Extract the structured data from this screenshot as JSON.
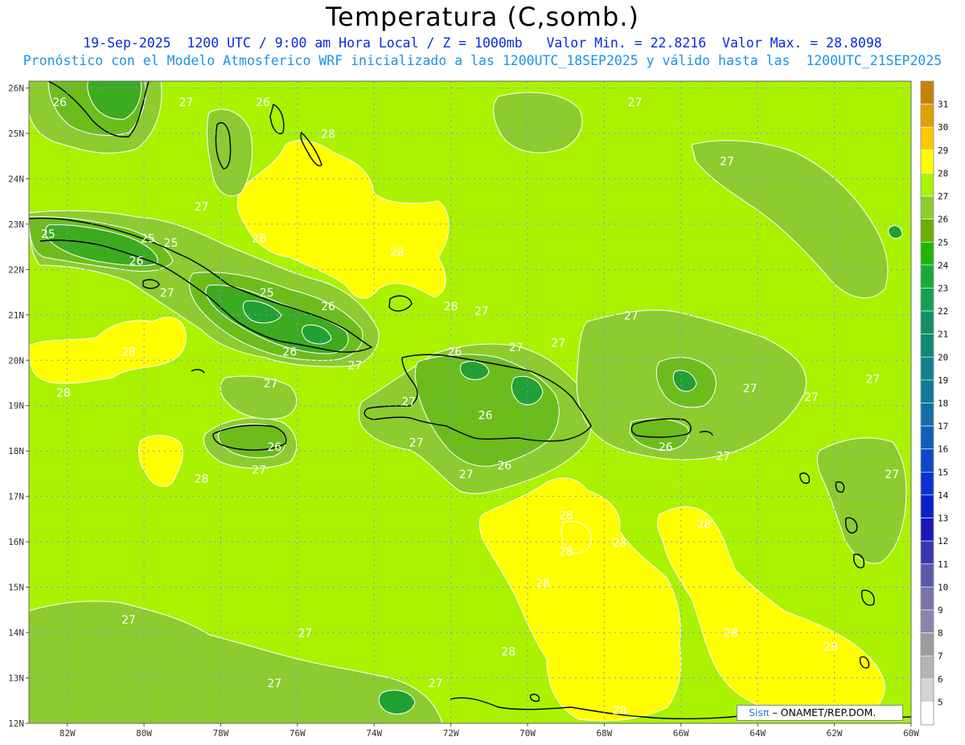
{
  "header": {
    "title": "Temperatura (C,somb.)",
    "subtitle_line1": "19-Sep-2025  1200 UTC / 9:00 am Hora Local / Z = 1000mb   Valor Min. = 22.8216  Valor Max. = 28.8098",
    "subtitle_line2": "Pronóstico con el Modelo Atmosferico WRF inicializado a las 1200UTC_18SEP2025 y válido hasta las  1200UTC_21SEP2025"
  },
  "colors": {
    "base_field": "#aaf200",
    "warm_band": "#ffff00",
    "cool_band_27": "#8ccc2e",
    "cool_band_26": "#6cbd1c",
    "cool_band_25": "#3dab20",
    "cool_band_24": "#22a034",
    "coastline": "#000000",
    "contour": "#ffffff",
    "grid": "#8b8bff"
  },
  "map": {
    "lat_labels": [
      "26N",
      "25N",
      "24N",
      "23N",
      "22N",
      "21N",
      "20N",
      "19N",
      "18N",
      "17N",
      "16N",
      "15N",
      "14N",
      "13N",
      "12N"
    ],
    "lon_labels": [
      "82W",
      "80W",
      "78W",
      "76W",
      "74W",
      "72W",
      "70W",
      "68W",
      "66W",
      "64W",
      "62W",
      "60W"
    ],
    "contour_labels": [
      {
        "t": "26",
        "lon": -82.2,
        "lat": 25.6
      },
      {
        "t": "27",
        "lon": -78.9,
        "lat": 25.6
      },
      {
        "t": "26",
        "lon": -76.9,
        "lat": 25.6
      },
      {
        "t": "28",
        "lon": -75.2,
        "lat": 24.9
      },
      {
        "t": "27",
        "lon": -67.2,
        "lat": 25.6
      },
      {
        "t": "27",
        "lon": -64.8,
        "lat": 24.3
      },
      {
        "t": "27",
        "lon": -78.5,
        "lat": 23.3
      },
      {
        "t": "25",
        "lon": -82.5,
        "lat": 22.7
      },
      {
        "t": "25",
        "lon": -79.9,
        "lat": 22.6
      },
      {
        "t": "25",
        "lon": -79.3,
        "lat": 22.5
      },
      {
        "t": "28",
        "lon": -77.0,
        "lat": 22.6
      },
      {
        "t": "28",
        "lon": -73.4,
        "lat": 22.3
      },
      {
        "t": "26",
        "lon": -80.2,
        "lat": 22.1
      },
      {
        "t": "27",
        "lon": -79.4,
        "lat": 21.4
      },
      {
        "t": "25",
        "lon": -76.8,
        "lat": 21.4
      },
      {
        "t": "26",
        "lon": -75.2,
        "lat": 21.1
      },
      {
        "t": "28",
        "lon": -72.0,
        "lat": 21.1
      },
      {
        "t": "27",
        "lon": -71.2,
        "lat": 21.0
      },
      {
        "t": "27",
        "lon": -67.3,
        "lat": 20.9
      },
      {
        "t": "27",
        "lon": -69.2,
        "lat": 20.3
      },
      {
        "t": "27",
        "lon": -70.3,
        "lat": 20.2
      },
      {
        "t": "28",
        "lon": -80.4,
        "lat": 20.1
      },
      {
        "t": "26",
        "lon": -76.2,
        "lat": 20.1
      },
      {
        "t": "26",
        "lon": -71.9,
        "lat": 20.1
      },
      {
        "t": "27",
        "lon": -74.5,
        "lat": 19.8
      },
      {
        "t": "27",
        "lon": -76.7,
        "lat": 19.4
      },
      {
        "t": "28",
        "lon": -82.1,
        "lat": 19.2
      },
      {
        "t": "27",
        "lon": -73.1,
        "lat": 19.0
      },
      {
        "t": "26",
        "lon": -71.1,
        "lat": 18.7
      },
      {
        "t": "27",
        "lon": -64.2,
        "lat": 19.3
      },
      {
        "t": "27",
        "lon": -62.6,
        "lat": 19.1
      },
      {
        "t": "27",
        "lon": -61.0,
        "lat": 19.5
      },
      {
        "t": "26",
        "lon": -76.6,
        "lat": 18.0
      },
      {
        "t": "27",
        "lon": -72.9,
        "lat": 18.1
      },
      {
        "t": "26",
        "lon": -66.4,
        "lat": 18.0
      },
      {
        "t": "27",
        "lon": -64.9,
        "lat": 17.8
      },
      {
        "t": "27",
        "lon": -77.0,
        "lat": 17.5
      },
      {
        "t": "26",
        "lon": -70.6,
        "lat": 17.6
      },
      {
        "t": "27",
        "lon": -71.6,
        "lat": 17.4
      },
      {
        "t": "28",
        "lon": -78.5,
        "lat": 17.3
      },
      {
        "t": "27",
        "lon": -60.5,
        "lat": 17.4
      },
      {
        "t": "28",
        "lon": -69.0,
        "lat": 16.5
      },
      {
        "t": "28",
        "lon": -65.4,
        "lat": 16.3
      },
      {
        "t": "28",
        "lon": -67.6,
        "lat": 15.9
      },
      {
        "t": "28",
        "lon": -69.0,
        "lat": 15.7
      },
      {
        "t": "28",
        "lon": -69.6,
        "lat": 15.0
      },
      {
        "t": "27",
        "lon": -80.4,
        "lat": 14.2
      },
      {
        "t": "27",
        "lon": -75.8,
        "lat": 13.9
      },
      {
        "t": "28",
        "lon": -64.7,
        "lat": 13.9
      },
      {
        "t": "28",
        "lon": -70.5,
        "lat": 13.5
      },
      {
        "t": "28",
        "lon": -62.1,
        "lat": 13.6
      },
      {
        "t": "27",
        "lon": -76.6,
        "lat": 12.8
      },
      {
        "t": "27",
        "lon": -72.4,
        "lat": 12.8
      },
      {
        "t": "28",
        "lon": -67.6,
        "lat": 12.2
      }
    ]
  },
  "colorbar": {
    "labels": [
      "31",
      "30",
      "29",
      "28",
      "27",
      "26",
      "25",
      "24",
      "23",
      "22",
      "21",
      "20",
      "19",
      "18",
      "17",
      "16",
      "15",
      "14",
      "13",
      "12",
      "11",
      "10",
      "9",
      "8",
      "7",
      "6",
      "5"
    ],
    "colors": [
      "#c88200",
      "#e0a000",
      "#ffc800",
      "#ffff00",
      "#aaf200",
      "#8ccc2e",
      "#6cae00",
      "#22b400",
      "#18aa38",
      "#14a04e",
      "#129062",
      "#128876",
      "#12808a",
      "#107898",
      "#1070a8",
      "#0e60b8",
      "#0c48c8",
      "#0a32d0",
      "#0a20c8",
      "#1818b8",
      "#3838b0",
      "#5a5aac",
      "#7a72a8",
      "#8c84b0",
      "#9c9c9c",
      "#b4b4b4",
      "#d4d4d4",
      "#ffffff"
    ]
  },
  "credit": {
    "logo_text": "Sisπ",
    "org_text": "– ONAMET/REP.DOM."
  }
}
